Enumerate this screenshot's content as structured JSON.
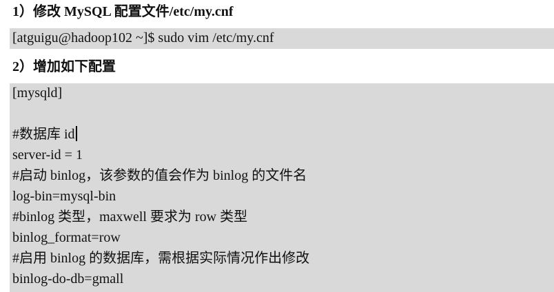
{
  "step1": {
    "heading": "1）修改 MySQL 配置文件/etc/my.cnf",
    "command": "[atguigu@hadoop102 ~]$ sudo vim /etc/my.cnf"
  },
  "step2": {
    "heading": "2）增加如下配置",
    "config_lines": [
      "[mysqld]",
      "",
      "#数据库 id",
      "server-id = 1",
      "#启动 binlog，该参数的值会作为 binlog 的文件名",
      "log-bin=mysql-bin",
      "#binlog 类型，maxwell 要求为 row 类型",
      "binlog_format=row",
      "#启用 binlog 的数据库，需根据实际情况作出修改",
      "binlog-do-db=gmall"
    ]
  }
}
